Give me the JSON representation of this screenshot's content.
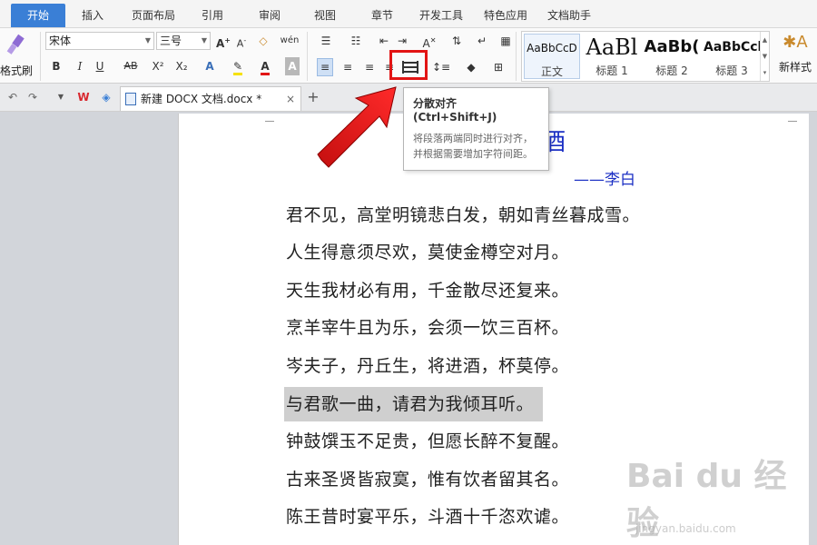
{
  "menu": {
    "tabs": [
      "开始",
      "插入",
      "页面布局",
      "引用",
      "审阅",
      "视图",
      "章节",
      "开发工具",
      "特色应用",
      "文档助手"
    ],
    "active": "开始"
  },
  "ribbon": {
    "format_painter": "格式刷",
    "font_name": "宋体",
    "font_size": "三号",
    "bold": "B",
    "italic": "I",
    "underline": "U",
    "strike": "AB",
    "superscript": "X²",
    "subscript": "X₂",
    "new_style": "新样式",
    "styles": [
      {
        "sample": "AaBbCcD",
        "name": "正文"
      },
      {
        "sample": "AaBl",
        "name": "标题 1"
      },
      {
        "sample": "AaBb(",
        "name": "标题 2"
      },
      {
        "sample": "AaBbCcl",
        "name": "标题 3"
      }
    ]
  },
  "document_tab": {
    "title": "新建 DOCX 文档.docx *",
    "close": "×",
    "new_tab": "+"
  },
  "tooltip": {
    "title": "分散对齐 (Ctrl+Shift+J)",
    "body": "将段落两端同时进行对齐，并根据需要增加字符间距。"
  },
  "document": {
    "title": "酒",
    "author": "——李白",
    "lines": [
      "君不见，高堂明镜悲白发，朝如青丝暮成雪。",
      "人生得意须尽欢，莫使金樽空对月。",
      "天生我材必有用，千金散尽还复来。",
      "烹羊宰牛且为乐，会须一饮三百杯。",
      "岑夫子，丹丘生，将进酒，杯莫停。",
      "与君歌一曲，请君为我倾耳听。",
      "钟鼓馔玉不足贵，但愿长醉不复醒。",
      "古来圣贤皆寂寞，惟有饮者留其名。",
      "陈王昔时宴平乐，斗酒十千恣欢谑。"
    ]
  },
  "watermark": {
    "logo": "Bai du 经验",
    "url": "jingyan.baidu.com"
  },
  "colors": {
    "accent": "#3a7fd6",
    "title_text": "#1b2fc4",
    "highlight_box": "#e21414",
    "selection": "#cfcfcf"
  }
}
